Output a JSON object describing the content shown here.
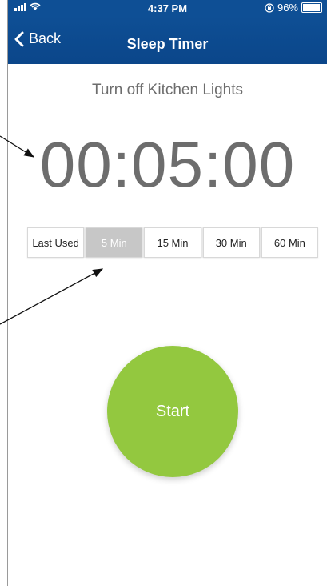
{
  "status_bar": {
    "time": "4:37 PM",
    "battery": "96%",
    "battery_level": 0.96
  },
  "nav": {
    "back_label": "Back",
    "title": "Sleep Timer"
  },
  "device_name": "Turn off Kitchen Lights",
  "timer": "00:05:00",
  "presets": [
    {
      "label": "Last Used",
      "selected": false
    },
    {
      "label": "5 Min",
      "selected": true
    },
    {
      "label": "15 Min",
      "selected": false
    },
    {
      "label": "30 Min",
      "selected": false
    },
    {
      "label": "60 Min",
      "selected": false
    }
  ],
  "start_label": "Start",
  "colors": {
    "nav_blue": "#0e4f95",
    "start_green": "#93c83f",
    "selected_gray": "#c7c7c7",
    "text_gray": "#6d6d6d"
  }
}
